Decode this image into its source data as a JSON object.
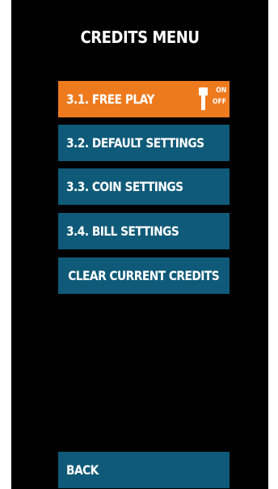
{
  "header": {
    "title": "CREDITS MENU"
  },
  "menu": {
    "items": [
      {
        "label": "3.1. FREE PLAY",
        "state": "selected"
      },
      {
        "label": "3.2. DEFAULT SETTINGS"
      },
      {
        "label": "3.3. COIN SETTINGS"
      },
      {
        "label": "3.4. BILL SETTINGS"
      },
      {
        "label": "CLEAR CURRENT CREDITS"
      }
    ]
  },
  "free_play_toggle": {
    "on_label": "ON",
    "off_label": "OFF",
    "icon": "lever-switch-icon"
  },
  "footer": {
    "back_label": "BACK"
  },
  "colors": {
    "background": "#000000",
    "button": "#0f5a78",
    "active_button": "#ee7a1e",
    "text": "#ffffff"
  }
}
